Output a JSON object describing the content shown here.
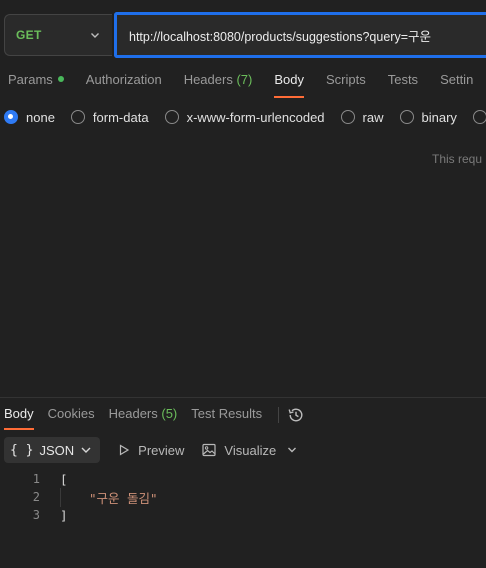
{
  "request": {
    "method": "GET",
    "url": "http://localhost:8080/products/suggestions?query=구운"
  },
  "request_tabs": [
    {
      "label": "Params",
      "dot": true
    },
    {
      "label": "Authorization"
    },
    {
      "label": "Headers",
      "count": "(7)"
    },
    {
      "label": "Body",
      "active": true
    },
    {
      "label": "Scripts"
    },
    {
      "label": "Tests"
    },
    {
      "label": "Settin"
    }
  ],
  "body_types": [
    {
      "label": "none",
      "checked": true
    },
    {
      "label": "form-data"
    },
    {
      "label": "x-www-form-urlencoded"
    },
    {
      "label": "raw"
    },
    {
      "label": "binary"
    }
  ],
  "body_hint": "This requ",
  "response_tabs": [
    {
      "label": "Body",
      "active": true
    },
    {
      "label": "Cookies"
    },
    {
      "label": "Headers",
      "count": "(5)"
    },
    {
      "label": "Test Results"
    }
  ],
  "response_toolbar": {
    "format": "JSON",
    "preview": "Preview",
    "visualize": "Visualize"
  },
  "response_body": [
    {
      "n": "1",
      "text": "["
    },
    {
      "n": "2",
      "text": "\"구운 돌김\""
    },
    {
      "n": "3",
      "text": "]"
    }
  ],
  "colors": {
    "accent": "#ff6c37",
    "url_focus": "#1f6feb",
    "method_get": "#6bbd5b",
    "radio_checked": "#2f7bf5"
  }
}
